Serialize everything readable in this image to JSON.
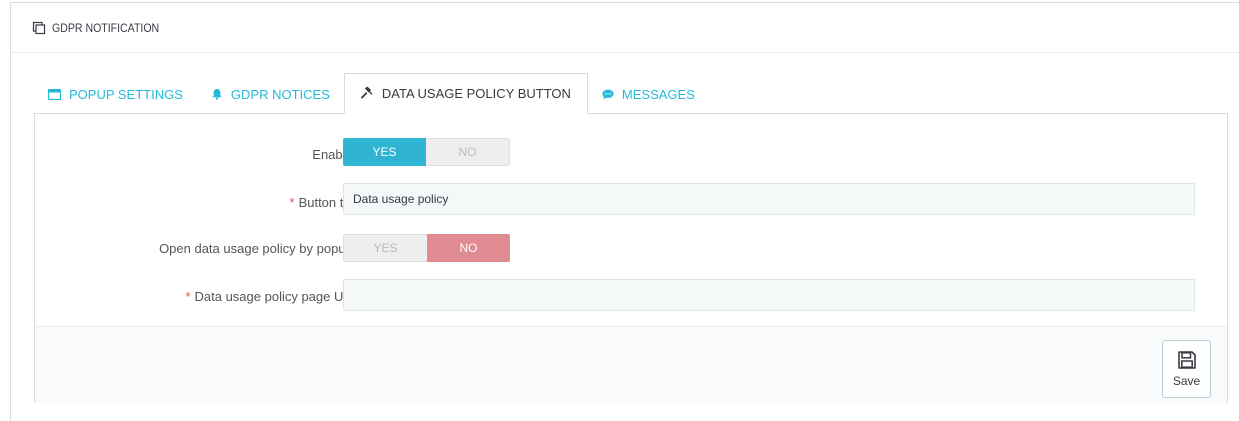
{
  "panel": {
    "title": "GDPR NOTIFICATION",
    "icon": "copy-icon"
  },
  "tabs": [
    {
      "label": "POPUP SETTINGS",
      "icon": "window-icon",
      "active": false
    },
    {
      "label": "GDPR NOTICES",
      "icon": "bell-icon",
      "active": false
    },
    {
      "label": "DATA USAGE POLICY BUTTON",
      "icon": "gavel-icon",
      "active": true
    },
    {
      "label": "MESSAGES",
      "icon": "chat-bubble-icon",
      "active": false
    }
  ],
  "form": {
    "enabled": {
      "label": "Enabled",
      "yes": "YES",
      "no": "NO",
      "value": "YES"
    },
    "button_title": {
      "label": "Button title",
      "required_mark": "*",
      "value": "Data usage policy",
      "placeholder": ""
    },
    "open_by_popup": {
      "label": "Open data usage policy by popup?",
      "yes": "YES",
      "no": "NO",
      "value": "NO"
    },
    "page_url": {
      "label": "Data usage policy page URL",
      "required_mark": "*",
      "value": "",
      "placeholder": ""
    }
  },
  "footer": {
    "save_label": "Save",
    "save_icon": "floppy-disk-icon"
  },
  "colors": {
    "accent": "#25b9d7",
    "switch_yes": "#2fb5d2",
    "switch_no": "#e08a91",
    "required": "#e84e4e"
  }
}
